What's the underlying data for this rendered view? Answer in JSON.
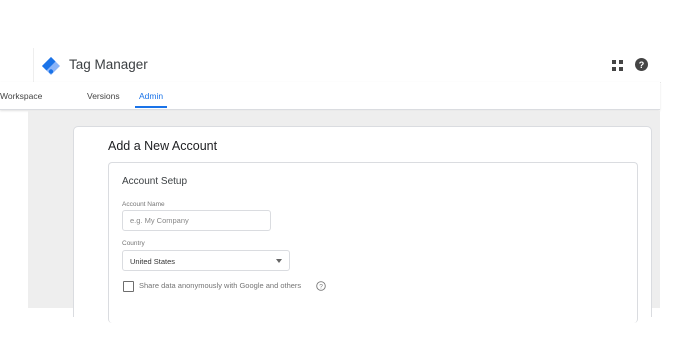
{
  "header": {
    "app_title": "Tag Manager",
    "logo_icon": "tag-manager-logo",
    "apps_icon": "apps-grid-icon",
    "help_icon": "help-icon"
  },
  "tabs": [
    {
      "label": "Workspace",
      "active": false
    },
    {
      "label": "Versions",
      "active": false
    },
    {
      "label": "Admin",
      "active": true
    }
  ],
  "form": {
    "title": "Add a New Account",
    "section_title": "Account Setup",
    "account_name": {
      "label": "Account Name",
      "placeholder": "e.g. My Company",
      "value": ""
    },
    "country": {
      "label": "Country",
      "selected": "United States"
    },
    "share_data": {
      "label": "Share data anonymously with Google and others",
      "checked": false
    }
  },
  "colors": {
    "accent": "#1a73e8",
    "logo_light": "#8ab4f8",
    "logo_dark": "#1a73e8",
    "workarea_bg": "#eeeeee"
  }
}
